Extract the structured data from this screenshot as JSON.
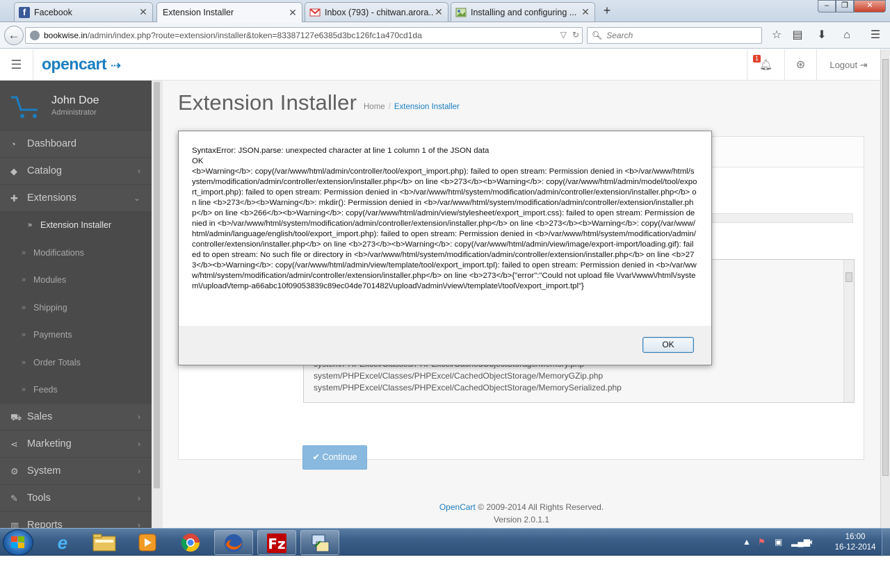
{
  "browser": {
    "tabs": [
      {
        "title": "Facebook",
        "favicon": "facebook-icon"
      },
      {
        "title": "Extension Installer",
        "favicon": "opencart-icon"
      },
      {
        "title": "Inbox (793) - chitwan.arora...",
        "favicon": "gmail-icon"
      },
      {
        "title": "Installing and configuring ...",
        "favicon": "page-icon"
      }
    ],
    "window_controls": {
      "minimize": "–",
      "maximize": "❐",
      "close": "✕"
    },
    "url": {
      "host": "bookwise.in",
      "path": "/admin/index.php?route=extension/installer&token=83387127e6385d3bc126fc1a470cd1da"
    },
    "search_placeholder": "Search",
    "toolbar_icons": [
      "star-icon",
      "reader-icon",
      "download-icon",
      "home-icon",
      "menu-icon"
    ]
  },
  "header": {
    "logo": "opencart",
    "notification_count": "1",
    "logout_label": "Logout"
  },
  "sidebar": {
    "user_name": "John Doe",
    "user_role": "Administrator",
    "items": [
      {
        "label": "Dashboard",
        "icon": "dashboard-icon"
      },
      {
        "label": "Catalog",
        "icon": "tag-icon"
      },
      {
        "label": "Extensions",
        "icon": "puzzle-icon"
      },
      {
        "label": "Sales",
        "icon": "cart-icon"
      },
      {
        "label": "Marketing",
        "icon": "share-icon"
      },
      {
        "label": "System",
        "icon": "gear-icon"
      },
      {
        "label": "Tools",
        "icon": "wrench-icon"
      },
      {
        "label": "Reports",
        "icon": "chart-icon"
      }
    ],
    "extension_subitems": [
      "Extension Installer",
      "Modifications",
      "Modules",
      "Shipping",
      "Payments",
      "Order Totals",
      "Feeds"
    ]
  },
  "content": {
    "page_title": "Extension Installer",
    "breadcrumb": [
      "Home",
      "Extension Installer"
    ],
    "overview_lines": [
      "system/PHPExcel/Classes/PHPExcel/CachedObjectStorage/Memory.php",
      "system/PHPExcel/Classes/PHPExcel/CachedObjectStorage/MemoryGZip.php",
      "system/PHPExcel/Classes/PHPExcel/CachedObjectStorage/MemorySerialized.php"
    ],
    "continue_label": "Continue",
    "footer_brand": "OpenCart",
    "footer_copyright": " © 2009-2014 All Rights Reserved.",
    "footer_version": "Version 2.0.1.1"
  },
  "dialog": {
    "message": "SyntaxError: JSON.parse: unexpected character at line 1 column 1 of the JSON data\nOK\n<b>Warning</b>: copy(/var/www/html/admin/controller/tool/export_import.php): failed to open stream: Permission denied in <b>/var/www/html/system/modification/admin/controller/extension/installer.php</b> on line <b>273</b><b>Warning</b>: copy(/var/www/html/admin/model/tool/export_import.php): failed to open stream: Permission denied in <b>/var/www/html/system/modification/admin/controller/extension/installer.php</b> on line <b>273</b><b>Warning</b>: mkdir(): Permission denied in <b>/var/www/html/system/modification/admin/controller/extension/installer.php</b> on line <b>266</b><b>Warning</b>: copy(/var/www/html/admin/view/stylesheet/export_import.css): failed to open stream: Permission denied in <b>/var/www/html/system/modification/admin/controller/extension/installer.php</b> on line <b>273</b><b>Warning</b>: copy(/var/www/html/admin/language/english/tool/export_import.php): failed to open stream: Permission denied in <b>/var/www/html/system/modification/admin/controller/extension/installer.php</b> on line <b>273</b><b>Warning</b>: copy(/var/www/html/admin/view/image/export-import/loading.gif): failed to open stream: No such file or directory in <b>/var/www/html/system/modification/admin/controller/extension/installer.php</b> on line <b>273</b><b>Warning</b>: copy(/var/www/html/admin/view/template/tool/export_import.tpl): failed to open stream: Permission denied in <b>/var/www/html/system/modification/admin/controller/extension/installer.php</b> on line <b>273</b>{\"error\":\"Could not upload file \\/var\\/www\\/html\\/system\\/upload\\/temp-a66abc10f09053839c89ec04de701482\\/upload\\/admin\\/view\\/template\\/tool\\/export_import.tpl\"}",
    "ok_label": "OK"
  },
  "taskbar": {
    "apps": [
      "internet-explorer-icon",
      "file-explorer-icon",
      "media-player-icon",
      "chrome-icon",
      "firefox-icon",
      "filezilla-icon",
      "network-icon"
    ],
    "clock_time": "16:00",
    "clock_date": "16-12-2014"
  }
}
